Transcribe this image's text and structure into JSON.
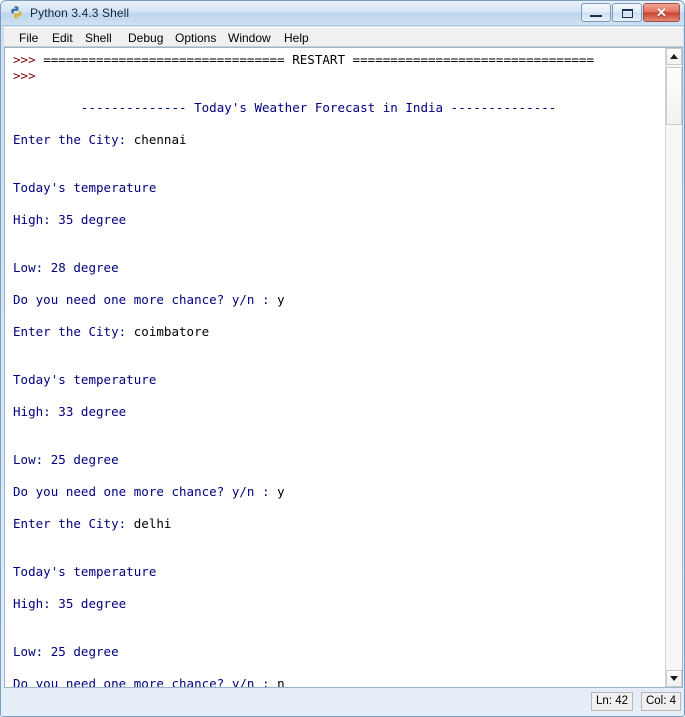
{
  "window": {
    "title": "Python 3.4.3 Shell",
    "icon": "python-logo-icon",
    "controls": {
      "minimize": "–",
      "maximize": "□",
      "close": "✕"
    }
  },
  "menubar": {
    "items": [
      {
        "label": "File"
      },
      {
        "label": "Edit"
      },
      {
        "label": "Shell"
      },
      {
        "label": "Debug"
      },
      {
        "label": "Options"
      },
      {
        "label": "Window"
      },
      {
        "label": "Help"
      }
    ]
  },
  "shell": {
    "lines": [
      {
        "segments": [
          {
            "text": ">>> ",
            "color": "prompt"
          },
          {
            "text": "================================ RESTART ================================",
            "color": "black"
          }
        ]
      },
      {
        "segments": [
          {
            "text": ">>> ",
            "color": "prompt"
          }
        ]
      },
      {
        "segments": [
          {
            "text": "",
            "color": "out"
          }
        ]
      },
      {
        "segments": [
          {
            "text": "         -------------- Today's Weather Forecast in India --------------",
            "color": "out"
          }
        ]
      },
      {
        "segments": [
          {
            "text": "",
            "color": "out"
          }
        ]
      },
      {
        "segments": [
          {
            "text": "Enter the City: ",
            "color": "out"
          },
          {
            "text": "chennai",
            "color": "black"
          }
        ]
      },
      {
        "segments": [
          {
            "text": "",
            "color": "out"
          }
        ]
      },
      {
        "segments": [
          {
            "text": "",
            "color": "out"
          }
        ]
      },
      {
        "segments": [
          {
            "text": "Today's temperature",
            "color": "out"
          }
        ]
      },
      {
        "segments": [
          {
            "text": "",
            "color": "out"
          }
        ]
      },
      {
        "segments": [
          {
            "text": "High: 35 degree",
            "color": "out"
          }
        ]
      },
      {
        "segments": [
          {
            "text": "",
            "color": "out"
          }
        ]
      },
      {
        "segments": [
          {
            "text": "",
            "color": "out"
          }
        ]
      },
      {
        "segments": [
          {
            "text": "Low: 28 degree",
            "color": "out"
          }
        ]
      },
      {
        "segments": [
          {
            "text": "",
            "color": "out"
          }
        ]
      },
      {
        "segments": [
          {
            "text": "Do you need one more chance? y/n : ",
            "color": "out"
          },
          {
            "text": "y",
            "color": "black"
          }
        ]
      },
      {
        "segments": [
          {
            "text": "",
            "color": "out"
          }
        ]
      },
      {
        "segments": [
          {
            "text": "Enter the City: ",
            "color": "out"
          },
          {
            "text": "coimbatore",
            "color": "black"
          }
        ]
      },
      {
        "segments": [
          {
            "text": "",
            "color": "out"
          }
        ]
      },
      {
        "segments": [
          {
            "text": "",
            "color": "out"
          }
        ]
      },
      {
        "segments": [
          {
            "text": "Today's temperature",
            "color": "out"
          }
        ]
      },
      {
        "segments": [
          {
            "text": "",
            "color": "out"
          }
        ]
      },
      {
        "segments": [
          {
            "text": "High: 33 degree",
            "color": "out"
          }
        ]
      },
      {
        "segments": [
          {
            "text": "",
            "color": "out"
          }
        ]
      },
      {
        "segments": [
          {
            "text": "",
            "color": "out"
          }
        ]
      },
      {
        "segments": [
          {
            "text": "Low: 25 degree",
            "color": "out"
          }
        ]
      },
      {
        "segments": [
          {
            "text": "",
            "color": "out"
          }
        ]
      },
      {
        "segments": [
          {
            "text": "Do you need one more chance? y/n : ",
            "color": "out"
          },
          {
            "text": "y",
            "color": "black"
          }
        ]
      },
      {
        "segments": [
          {
            "text": "",
            "color": "out"
          }
        ]
      },
      {
        "segments": [
          {
            "text": "Enter the City: ",
            "color": "out"
          },
          {
            "text": "delhi",
            "color": "black"
          }
        ]
      },
      {
        "segments": [
          {
            "text": "",
            "color": "out"
          }
        ]
      },
      {
        "segments": [
          {
            "text": "",
            "color": "out"
          }
        ]
      },
      {
        "segments": [
          {
            "text": "Today's temperature",
            "color": "out"
          }
        ]
      },
      {
        "segments": [
          {
            "text": "",
            "color": "out"
          }
        ]
      },
      {
        "segments": [
          {
            "text": "High: 35 degree",
            "color": "out"
          }
        ]
      },
      {
        "segments": [
          {
            "text": "",
            "color": "out"
          }
        ]
      },
      {
        "segments": [
          {
            "text": "",
            "color": "out"
          }
        ]
      },
      {
        "segments": [
          {
            "text": "Low: 25 degree",
            "color": "out"
          }
        ]
      },
      {
        "segments": [
          {
            "text": "",
            "color": "out"
          }
        ]
      },
      {
        "segments": [
          {
            "text": "Do you need one more chance? y/n : ",
            "color": "out"
          },
          {
            "text": "n",
            "color": "black"
          }
        ]
      },
      {
        "segments": [
          {
            "text": ">>> ",
            "color": "prompt"
          }
        ],
        "caret": true
      }
    ]
  },
  "statusbar": {
    "line": "Ln: 42",
    "column": "Col: 4"
  },
  "colors": {
    "prompt": "#7f0000",
    "output": "#00007f",
    "input": "#000000",
    "background": "#ffffff",
    "frame": "#cfe0f2"
  }
}
